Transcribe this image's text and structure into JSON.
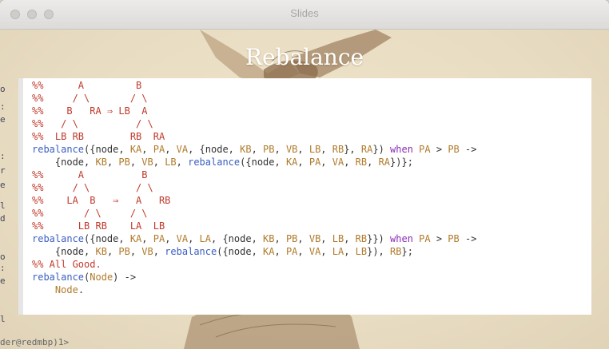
{
  "window": {
    "title": "Slides"
  },
  "slide": {
    "title": "Rebalance"
  },
  "code_lines": [
    [
      {
        "t": "%%      A         B",
        "c": "comment"
      }
    ],
    [
      {
        "t": "%%     / \\       / \\",
        "c": "comment"
      }
    ],
    [
      {
        "t": "%%    B   RA ⇒ LB  A",
        "c": "comment"
      }
    ],
    [
      {
        "t": "%%   / \\          / \\",
        "c": "comment"
      }
    ],
    [
      {
        "t": "%%  LB RB        RB  RA",
        "c": "comment"
      }
    ],
    [
      {
        "t": "rebalance",
        "c": "fn"
      },
      {
        "t": "({node, ",
        "c": "plain"
      },
      {
        "t": "KA",
        "c": "var"
      },
      {
        "t": ", ",
        "c": "plain"
      },
      {
        "t": "PA",
        "c": "var"
      },
      {
        "t": ", ",
        "c": "plain"
      },
      {
        "t": "VA",
        "c": "var"
      },
      {
        "t": ", {node, ",
        "c": "plain"
      },
      {
        "t": "KB",
        "c": "var"
      },
      {
        "t": ", ",
        "c": "plain"
      },
      {
        "t": "PB",
        "c": "var"
      },
      {
        "t": ", ",
        "c": "plain"
      },
      {
        "t": "VB",
        "c": "var"
      },
      {
        "t": ", ",
        "c": "plain"
      },
      {
        "t": "LB",
        "c": "var"
      },
      {
        "t": ", ",
        "c": "plain"
      },
      {
        "t": "RB",
        "c": "var"
      },
      {
        "t": "}, ",
        "c": "plain"
      },
      {
        "t": "RA",
        "c": "var"
      },
      {
        "t": "}) ",
        "c": "plain"
      },
      {
        "t": "when",
        "c": "kw"
      },
      {
        "t": " ",
        "c": "plain"
      },
      {
        "t": "PA",
        "c": "var"
      },
      {
        "t": " > ",
        "c": "plain"
      },
      {
        "t": "PB",
        "c": "var"
      },
      {
        "t": " ->",
        "c": "plain"
      }
    ],
    [
      {
        "t": "    {node, ",
        "c": "plain"
      },
      {
        "t": "KB",
        "c": "var"
      },
      {
        "t": ", ",
        "c": "plain"
      },
      {
        "t": "PB",
        "c": "var"
      },
      {
        "t": ", ",
        "c": "plain"
      },
      {
        "t": "VB",
        "c": "var"
      },
      {
        "t": ", ",
        "c": "plain"
      },
      {
        "t": "LB",
        "c": "var"
      },
      {
        "t": ", ",
        "c": "plain"
      },
      {
        "t": "rebalance",
        "c": "fn"
      },
      {
        "t": "({node, ",
        "c": "plain"
      },
      {
        "t": "KA",
        "c": "var"
      },
      {
        "t": ", ",
        "c": "plain"
      },
      {
        "t": "PA",
        "c": "var"
      },
      {
        "t": ", ",
        "c": "plain"
      },
      {
        "t": "VA",
        "c": "var"
      },
      {
        "t": ", ",
        "c": "plain"
      },
      {
        "t": "RB",
        "c": "var"
      },
      {
        "t": ", ",
        "c": "plain"
      },
      {
        "t": "RA",
        "c": "var"
      },
      {
        "t": "})};",
        "c": "plain"
      }
    ],
    [
      {
        "t": "%%      A          B",
        "c": "comment"
      }
    ],
    [
      {
        "t": "%%     / \\        / \\",
        "c": "comment"
      }
    ],
    [
      {
        "t": "%%    LA  B   ⇒   A   RB",
        "c": "comment"
      }
    ],
    [
      {
        "t": "%%       / \\     / \\",
        "c": "comment"
      }
    ],
    [
      {
        "t": "%%      LB RB    LA  LB",
        "c": "comment"
      }
    ],
    [
      {
        "t": "rebalance",
        "c": "fn"
      },
      {
        "t": "({node, ",
        "c": "plain"
      },
      {
        "t": "KA",
        "c": "var"
      },
      {
        "t": ", ",
        "c": "plain"
      },
      {
        "t": "PA",
        "c": "var"
      },
      {
        "t": ", ",
        "c": "plain"
      },
      {
        "t": "VA",
        "c": "var"
      },
      {
        "t": ", ",
        "c": "plain"
      },
      {
        "t": "LA",
        "c": "var"
      },
      {
        "t": ", {node, ",
        "c": "plain"
      },
      {
        "t": "KB",
        "c": "var"
      },
      {
        "t": ", ",
        "c": "plain"
      },
      {
        "t": "PB",
        "c": "var"
      },
      {
        "t": ", ",
        "c": "plain"
      },
      {
        "t": "VB",
        "c": "var"
      },
      {
        "t": ", ",
        "c": "plain"
      },
      {
        "t": "LB",
        "c": "var"
      },
      {
        "t": ", ",
        "c": "plain"
      },
      {
        "t": "RB",
        "c": "var"
      },
      {
        "t": "}}) ",
        "c": "plain"
      },
      {
        "t": "when",
        "c": "kw"
      },
      {
        "t": " ",
        "c": "plain"
      },
      {
        "t": "PA",
        "c": "var"
      },
      {
        "t": " > ",
        "c": "plain"
      },
      {
        "t": "PB",
        "c": "var"
      },
      {
        "t": " ->",
        "c": "plain"
      }
    ],
    [
      {
        "t": "    {node, ",
        "c": "plain"
      },
      {
        "t": "KB",
        "c": "var"
      },
      {
        "t": ", ",
        "c": "plain"
      },
      {
        "t": "PB",
        "c": "var"
      },
      {
        "t": ", ",
        "c": "plain"
      },
      {
        "t": "VB",
        "c": "var"
      },
      {
        "t": ", ",
        "c": "plain"
      },
      {
        "t": "rebalance",
        "c": "fn"
      },
      {
        "t": "({node, ",
        "c": "plain"
      },
      {
        "t": "KA",
        "c": "var"
      },
      {
        "t": ", ",
        "c": "plain"
      },
      {
        "t": "PA",
        "c": "var"
      },
      {
        "t": ", ",
        "c": "plain"
      },
      {
        "t": "VA",
        "c": "var"
      },
      {
        "t": ", ",
        "c": "plain"
      },
      {
        "t": "LA",
        "c": "var"
      },
      {
        "t": ", ",
        "c": "plain"
      },
      {
        "t": "LB",
        "c": "var"
      },
      {
        "t": "}), ",
        "c": "plain"
      },
      {
        "t": "RB",
        "c": "var"
      },
      {
        "t": "};",
        "c": "plain"
      }
    ],
    [
      {
        "t": "%% All Good.",
        "c": "comment"
      }
    ],
    [
      {
        "t": "rebalance",
        "c": "fn"
      },
      {
        "t": "(",
        "c": "plain"
      },
      {
        "t": "Node",
        "c": "var"
      },
      {
        "t": ") ->",
        "c": "plain"
      }
    ],
    [
      {
        "t": "    ",
        "c": "plain"
      },
      {
        "t": "Node",
        "c": "var"
      },
      {
        "t": ".",
        "c": "plain"
      }
    ]
  ],
  "colors": {
    "comment": "#c0392b",
    "fn": "#3b5fc0",
    "var": "#b07a2a",
    "kw": "#8a2bb8",
    "plain": "#333333"
  },
  "background_edge_text": {
    "left_glyphs": [
      "o",
      ":",
      "e",
      ":",
      "r",
      "e",
      "l",
      "d",
      "o",
      ":",
      "e",
      "l"
    ],
    "bottom_text": "der@redmbp)1>"
  }
}
